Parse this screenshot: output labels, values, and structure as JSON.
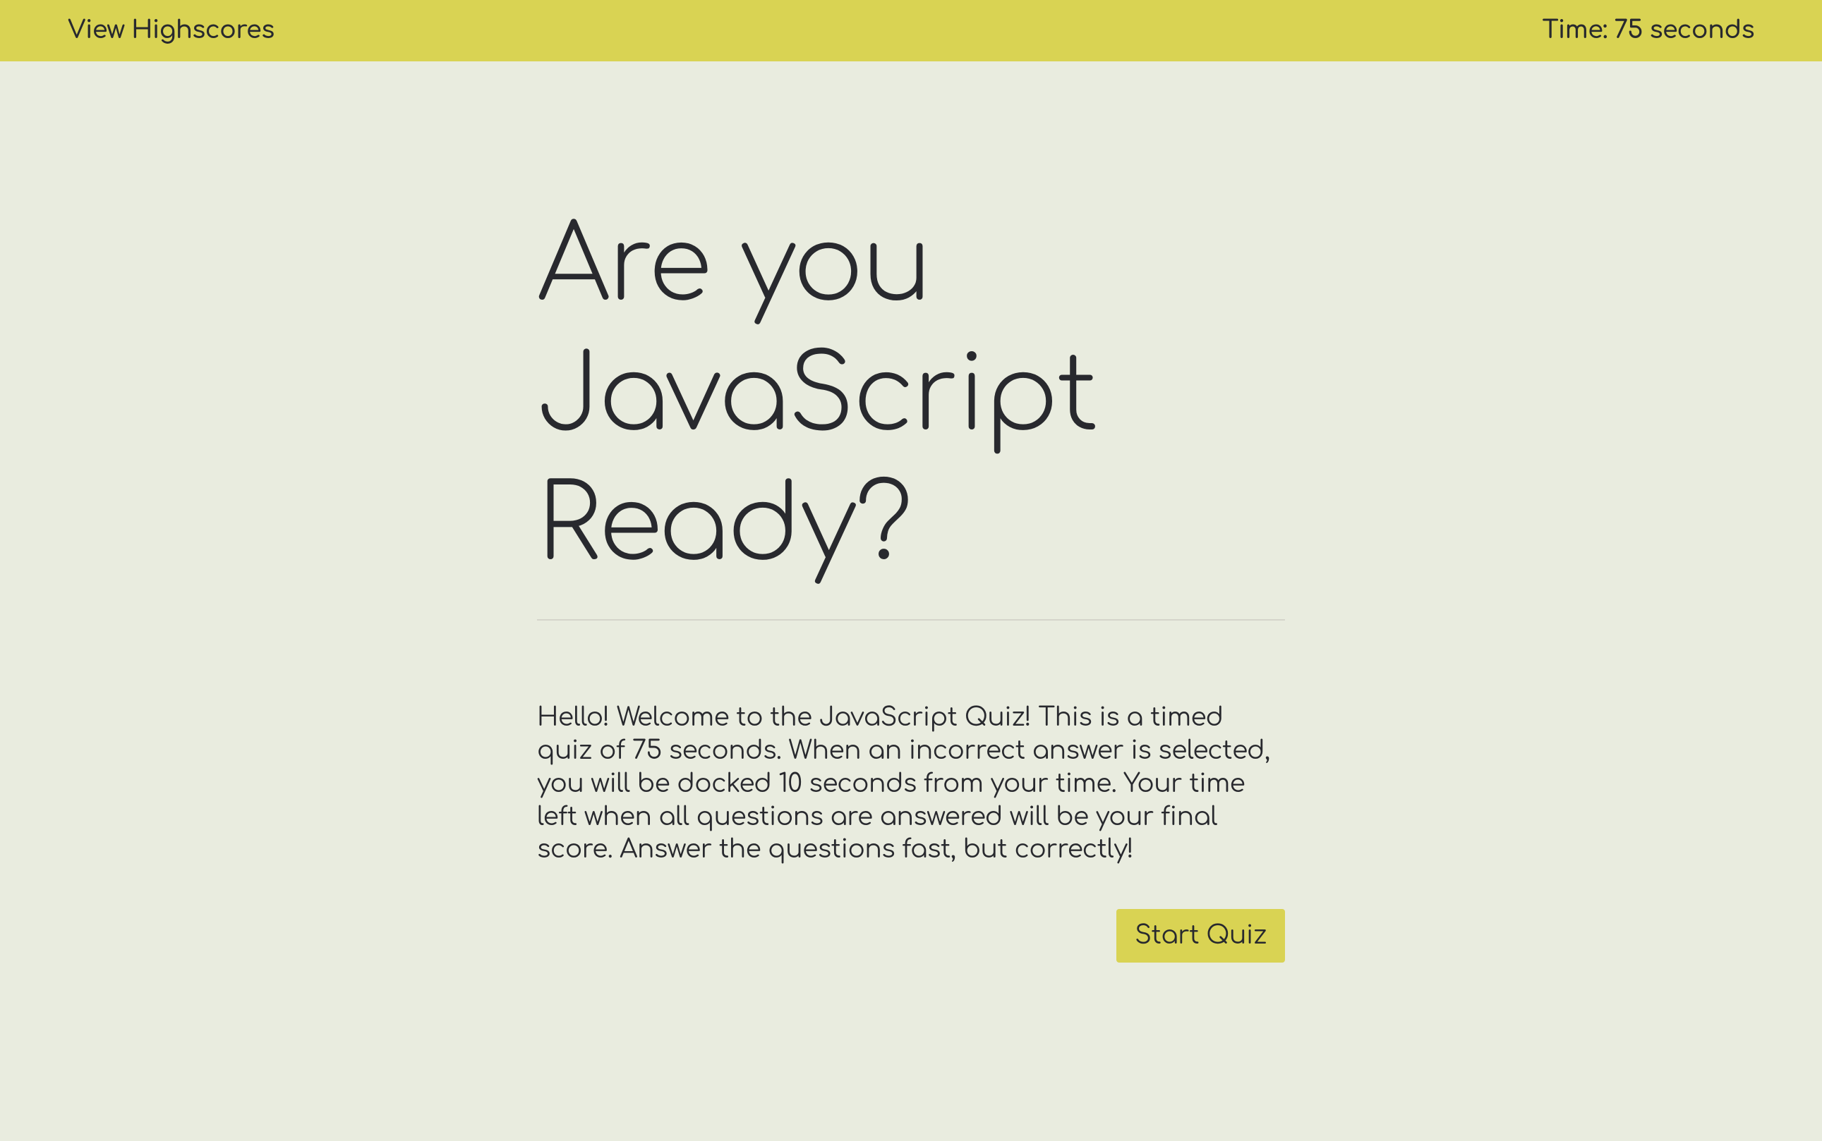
{
  "header": {
    "highscores_link": "View Highscores",
    "timer_prefix": "Time: ",
    "timer_value": "75",
    "timer_suffix": " seconds"
  },
  "main": {
    "title": "Are you JavaScript Ready?",
    "description": "Hello! Welcome to the JavaScript Quiz! This is a timed quiz of 75 seconds. When an incorrect answer is selected, you will be docked 10 seconds from your time. Your time left when all questions are answered will be your final score. Answer the questions fast, but correctly!",
    "start_button": "Start Quiz"
  }
}
